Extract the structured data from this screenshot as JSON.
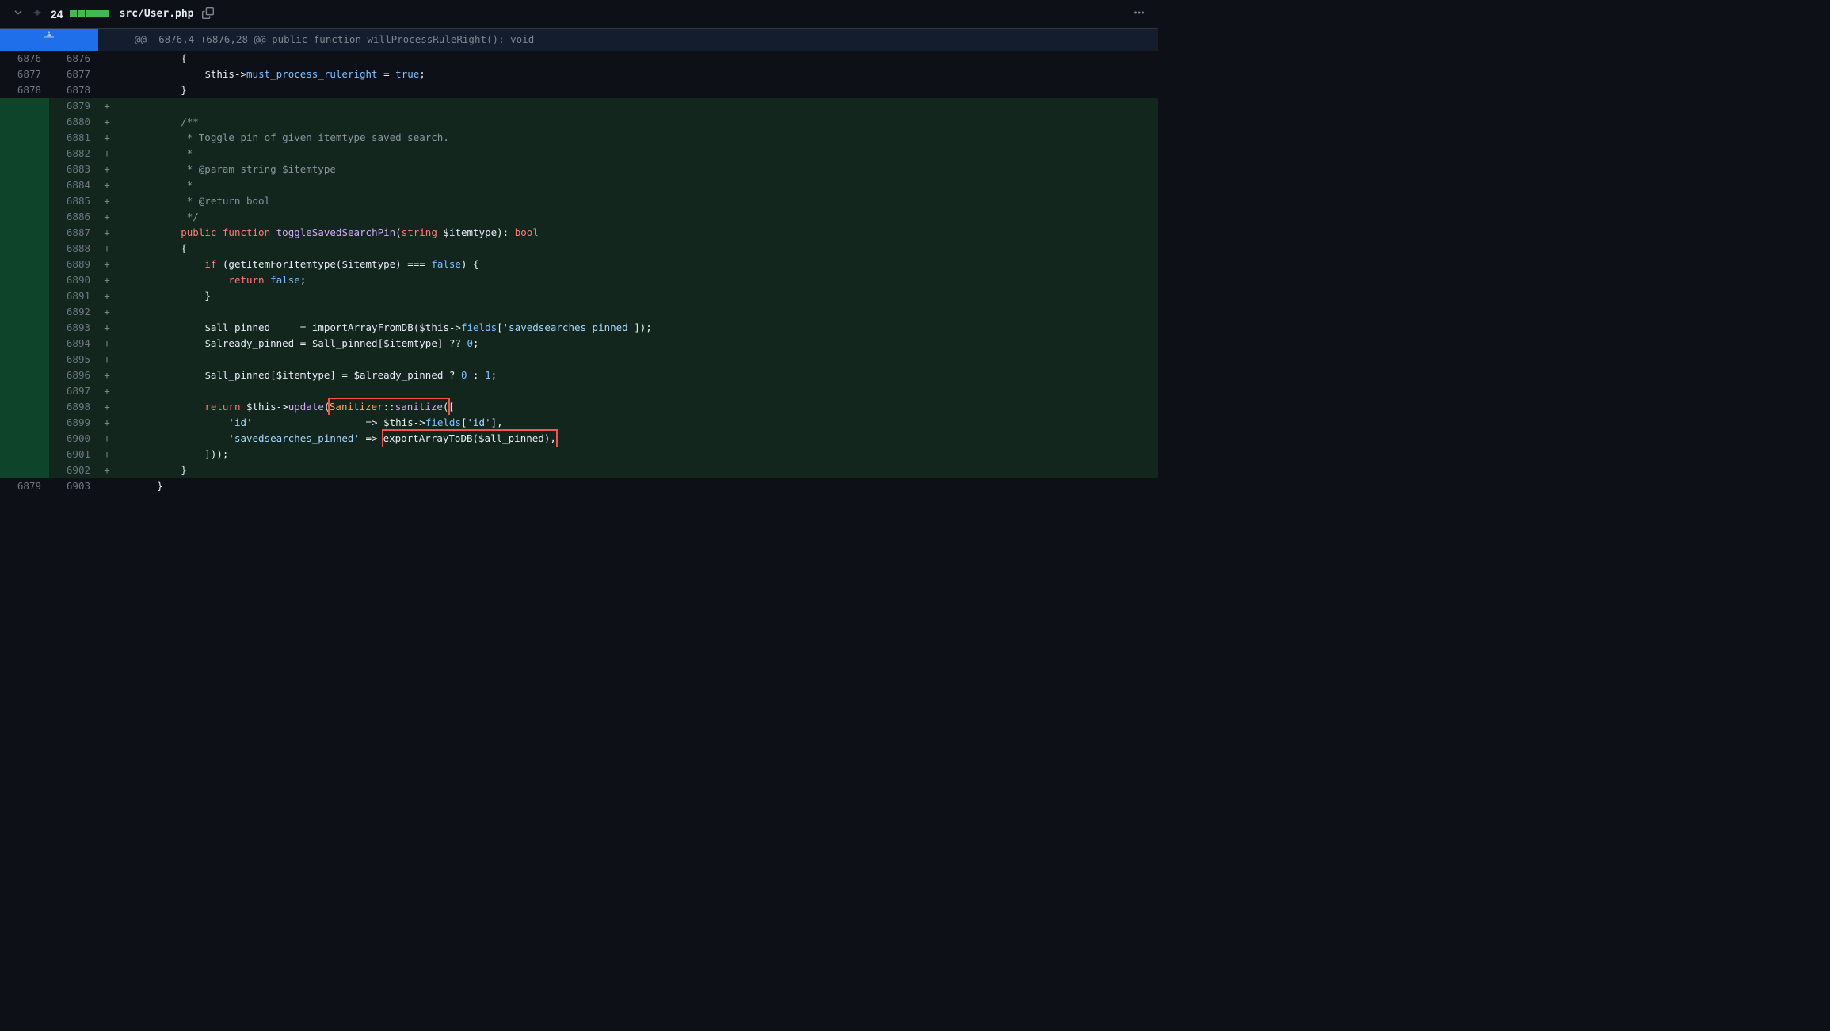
{
  "header": {
    "change_count": "24",
    "file_path": "src/User.php"
  },
  "hunk": {
    "text": "@@ -6876,4 +6876,28 @@ public function willProcessRuleRight(): void"
  },
  "lines": [
    {
      "old": "6876",
      "new": "6876",
      "type": "ctx",
      "marker": "",
      "tokens": [
        {
          "c": "c-pl",
          "t": "        {"
        }
      ]
    },
    {
      "old": "6877",
      "new": "6877",
      "type": "ctx",
      "marker": "",
      "tokens": [
        {
          "c": "c-pl",
          "t": "            "
        },
        {
          "c": "c-var",
          "t": "$this"
        },
        {
          "c": "c-pl",
          "t": "->"
        },
        {
          "c": "c-prop",
          "t": "must_process_ruleright"
        },
        {
          "c": "c-pl",
          "t": " = "
        },
        {
          "c": "c-const",
          "t": "true"
        },
        {
          "c": "c-pl",
          "t": ";"
        }
      ]
    },
    {
      "old": "6878",
      "new": "6878",
      "type": "ctx",
      "marker": "",
      "tokens": [
        {
          "c": "c-pl",
          "t": "        }"
        }
      ]
    },
    {
      "old": "",
      "new": "6879",
      "type": "add",
      "marker": "+",
      "tokens": [
        {
          "c": "c-pl",
          "t": ""
        }
      ]
    },
    {
      "old": "",
      "new": "6880",
      "type": "add",
      "marker": "+",
      "tokens": [
        {
          "c": "c-cmt",
          "t": "        /**"
        }
      ]
    },
    {
      "old": "",
      "new": "6881",
      "type": "add",
      "marker": "+",
      "tokens": [
        {
          "c": "c-cmt",
          "t": "         * Toggle pin of given itemtype saved search."
        }
      ]
    },
    {
      "old": "",
      "new": "6882",
      "type": "add",
      "marker": "+",
      "tokens": [
        {
          "c": "c-cmt",
          "t": "         *"
        }
      ]
    },
    {
      "old": "",
      "new": "6883",
      "type": "add",
      "marker": "+",
      "tokens": [
        {
          "c": "c-cmt",
          "t": "         * @param string $itemtype"
        }
      ]
    },
    {
      "old": "",
      "new": "6884",
      "type": "add",
      "marker": "+",
      "tokens": [
        {
          "c": "c-cmt",
          "t": "         *"
        }
      ]
    },
    {
      "old": "",
      "new": "6885",
      "type": "add",
      "marker": "+",
      "tokens": [
        {
          "c": "c-cmt",
          "t": "         * @return bool"
        }
      ]
    },
    {
      "old": "",
      "new": "6886",
      "type": "add",
      "marker": "+",
      "tokens": [
        {
          "c": "c-cmt",
          "t": "         */"
        }
      ]
    },
    {
      "old": "",
      "new": "6887",
      "type": "add",
      "marker": "+",
      "tokens": [
        {
          "c": "c-pl",
          "t": "        "
        },
        {
          "c": "c-kw",
          "t": "public"
        },
        {
          "c": "c-pl",
          "t": " "
        },
        {
          "c": "c-kw",
          "t": "function"
        },
        {
          "c": "c-pl",
          "t": " "
        },
        {
          "c": "c-fn",
          "t": "toggleSavedSearchPin"
        },
        {
          "c": "c-pl",
          "t": "("
        },
        {
          "c": "c-kw",
          "t": "string"
        },
        {
          "c": "c-pl",
          "t": " "
        },
        {
          "c": "c-var",
          "t": "$itemtype"
        },
        {
          "c": "c-pl",
          "t": "): "
        },
        {
          "c": "c-kw",
          "t": "bool"
        }
      ]
    },
    {
      "old": "",
      "new": "6888",
      "type": "add",
      "marker": "+",
      "tokens": [
        {
          "c": "c-pl",
          "t": "        {"
        }
      ]
    },
    {
      "old": "",
      "new": "6889",
      "type": "add",
      "marker": "+",
      "tokens": [
        {
          "c": "c-pl",
          "t": "            "
        },
        {
          "c": "c-kw",
          "t": "if"
        },
        {
          "c": "c-pl",
          "t": " (getItemForItemtype("
        },
        {
          "c": "c-var",
          "t": "$itemtype"
        },
        {
          "c": "c-pl",
          "t": ") === "
        },
        {
          "c": "c-const",
          "t": "false"
        },
        {
          "c": "c-pl",
          "t": ") {"
        }
      ]
    },
    {
      "old": "",
      "new": "6890",
      "type": "add",
      "marker": "+",
      "tokens": [
        {
          "c": "c-pl",
          "t": "                "
        },
        {
          "c": "c-kw",
          "t": "return"
        },
        {
          "c": "c-pl",
          "t": " "
        },
        {
          "c": "c-const",
          "t": "false"
        },
        {
          "c": "c-pl",
          "t": ";"
        }
      ]
    },
    {
      "old": "",
      "new": "6891",
      "type": "add",
      "marker": "+",
      "tokens": [
        {
          "c": "c-pl",
          "t": "            }"
        }
      ]
    },
    {
      "old": "",
      "new": "6892",
      "type": "add",
      "marker": "+",
      "tokens": [
        {
          "c": "c-pl",
          "t": ""
        }
      ]
    },
    {
      "old": "",
      "new": "6893",
      "type": "add",
      "marker": "+",
      "tokens": [
        {
          "c": "c-pl",
          "t": "            "
        },
        {
          "c": "c-var",
          "t": "$all_pinned"
        },
        {
          "c": "c-pl",
          "t": "     = importArrayFromDB("
        },
        {
          "c": "c-var",
          "t": "$this"
        },
        {
          "c": "c-pl",
          "t": "->"
        },
        {
          "c": "c-prop",
          "t": "fields"
        },
        {
          "c": "c-pl",
          "t": "["
        },
        {
          "c": "c-str",
          "t": "'savedsearches_pinned'"
        },
        {
          "c": "c-pl",
          "t": "]);"
        }
      ]
    },
    {
      "old": "",
      "new": "6894",
      "type": "add",
      "marker": "+",
      "tokens": [
        {
          "c": "c-pl",
          "t": "            "
        },
        {
          "c": "c-var",
          "t": "$already_pinned"
        },
        {
          "c": "c-pl",
          "t": " = "
        },
        {
          "c": "c-var",
          "t": "$all_pinned"
        },
        {
          "c": "c-pl",
          "t": "["
        },
        {
          "c": "c-var",
          "t": "$itemtype"
        },
        {
          "c": "c-pl",
          "t": "] ?? "
        },
        {
          "c": "c-num",
          "t": "0"
        },
        {
          "c": "c-pl",
          "t": ";"
        }
      ]
    },
    {
      "old": "",
      "new": "6895",
      "type": "add",
      "marker": "+",
      "tokens": [
        {
          "c": "c-pl",
          "t": ""
        }
      ]
    },
    {
      "old": "",
      "new": "6896",
      "type": "add",
      "marker": "+",
      "tokens": [
        {
          "c": "c-pl",
          "t": "            "
        },
        {
          "c": "c-var",
          "t": "$all_pinned"
        },
        {
          "c": "c-pl",
          "t": "["
        },
        {
          "c": "c-var",
          "t": "$itemtype"
        },
        {
          "c": "c-pl",
          "t": "] = "
        },
        {
          "c": "c-var",
          "t": "$already_pinned"
        },
        {
          "c": "c-pl",
          "t": " ? "
        },
        {
          "c": "c-num",
          "t": "0"
        },
        {
          "c": "c-pl",
          "t": " : "
        },
        {
          "c": "c-num",
          "t": "1"
        },
        {
          "c": "c-pl",
          "t": ";"
        }
      ]
    },
    {
      "old": "",
      "new": "6897",
      "type": "add",
      "marker": "+",
      "tokens": [
        {
          "c": "c-pl",
          "t": ""
        }
      ]
    },
    {
      "old": "",
      "new": "6898",
      "type": "add",
      "marker": "+",
      "tokens": [
        {
          "c": "c-pl",
          "t": "            "
        },
        {
          "c": "c-kw",
          "t": "return"
        },
        {
          "c": "c-pl",
          "t": " "
        },
        {
          "c": "c-var",
          "t": "$this"
        },
        {
          "c": "c-pl",
          "t": "->"
        },
        {
          "c": "c-fn",
          "t": "update"
        },
        {
          "c": "c-pl",
          "t": "("
        },
        {
          "hl": true,
          "inner": [
            {
              "c": "c-cls",
              "t": "Sanitizer"
            },
            {
              "c": "c-pl",
              "t": "::"
            },
            {
              "c": "c-fn",
              "t": "sanitize"
            },
            {
              "c": "c-pl",
              "t": "("
            }
          ]
        },
        {
          "c": "c-pl",
          "t": "["
        }
      ]
    },
    {
      "old": "",
      "new": "6899",
      "type": "add",
      "marker": "+",
      "tokens": [
        {
          "c": "c-pl",
          "t": "                "
        },
        {
          "c": "c-str",
          "t": "'id'"
        },
        {
          "c": "c-pl",
          "t": "                   => "
        },
        {
          "c": "c-var",
          "t": "$this"
        },
        {
          "c": "c-pl",
          "t": "->"
        },
        {
          "c": "c-prop",
          "t": "fields"
        },
        {
          "c": "c-pl",
          "t": "["
        },
        {
          "c": "c-str",
          "t": "'id'"
        },
        {
          "c": "c-pl",
          "t": "],"
        }
      ]
    },
    {
      "old": "",
      "new": "6900",
      "type": "add",
      "marker": "+",
      "tokens": [
        {
          "c": "c-pl",
          "t": "                "
        },
        {
          "c": "c-str",
          "t": "'savedsearches_pinned'"
        },
        {
          "c": "c-pl",
          "t": " => "
        },
        {
          "hl": true,
          "inner": [
            {
              "c": "c-pl",
              "t": "exportArrayToDB("
            },
            {
              "c": "c-var",
              "t": "$all_pinned"
            },
            {
              "c": "c-pl",
              "t": "),"
            }
          ]
        }
      ]
    },
    {
      "old": "",
      "new": "6901",
      "type": "add",
      "marker": "+",
      "tokens": [
        {
          "c": "c-pl",
          "t": "            ]));"
        }
      ]
    },
    {
      "old": "",
      "new": "6902",
      "type": "add",
      "marker": "+",
      "tokens": [
        {
          "c": "c-pl",
          "t": "        }"
        }
      ]
    },
    {
      "old": "6879",
      "new": "6903",
      "type": "ctx",
      "marker": "",
      "tokens": [
        {
          "c": "c-pl",
          "t": "    }"
        }
      ]
    }
  ]
}
